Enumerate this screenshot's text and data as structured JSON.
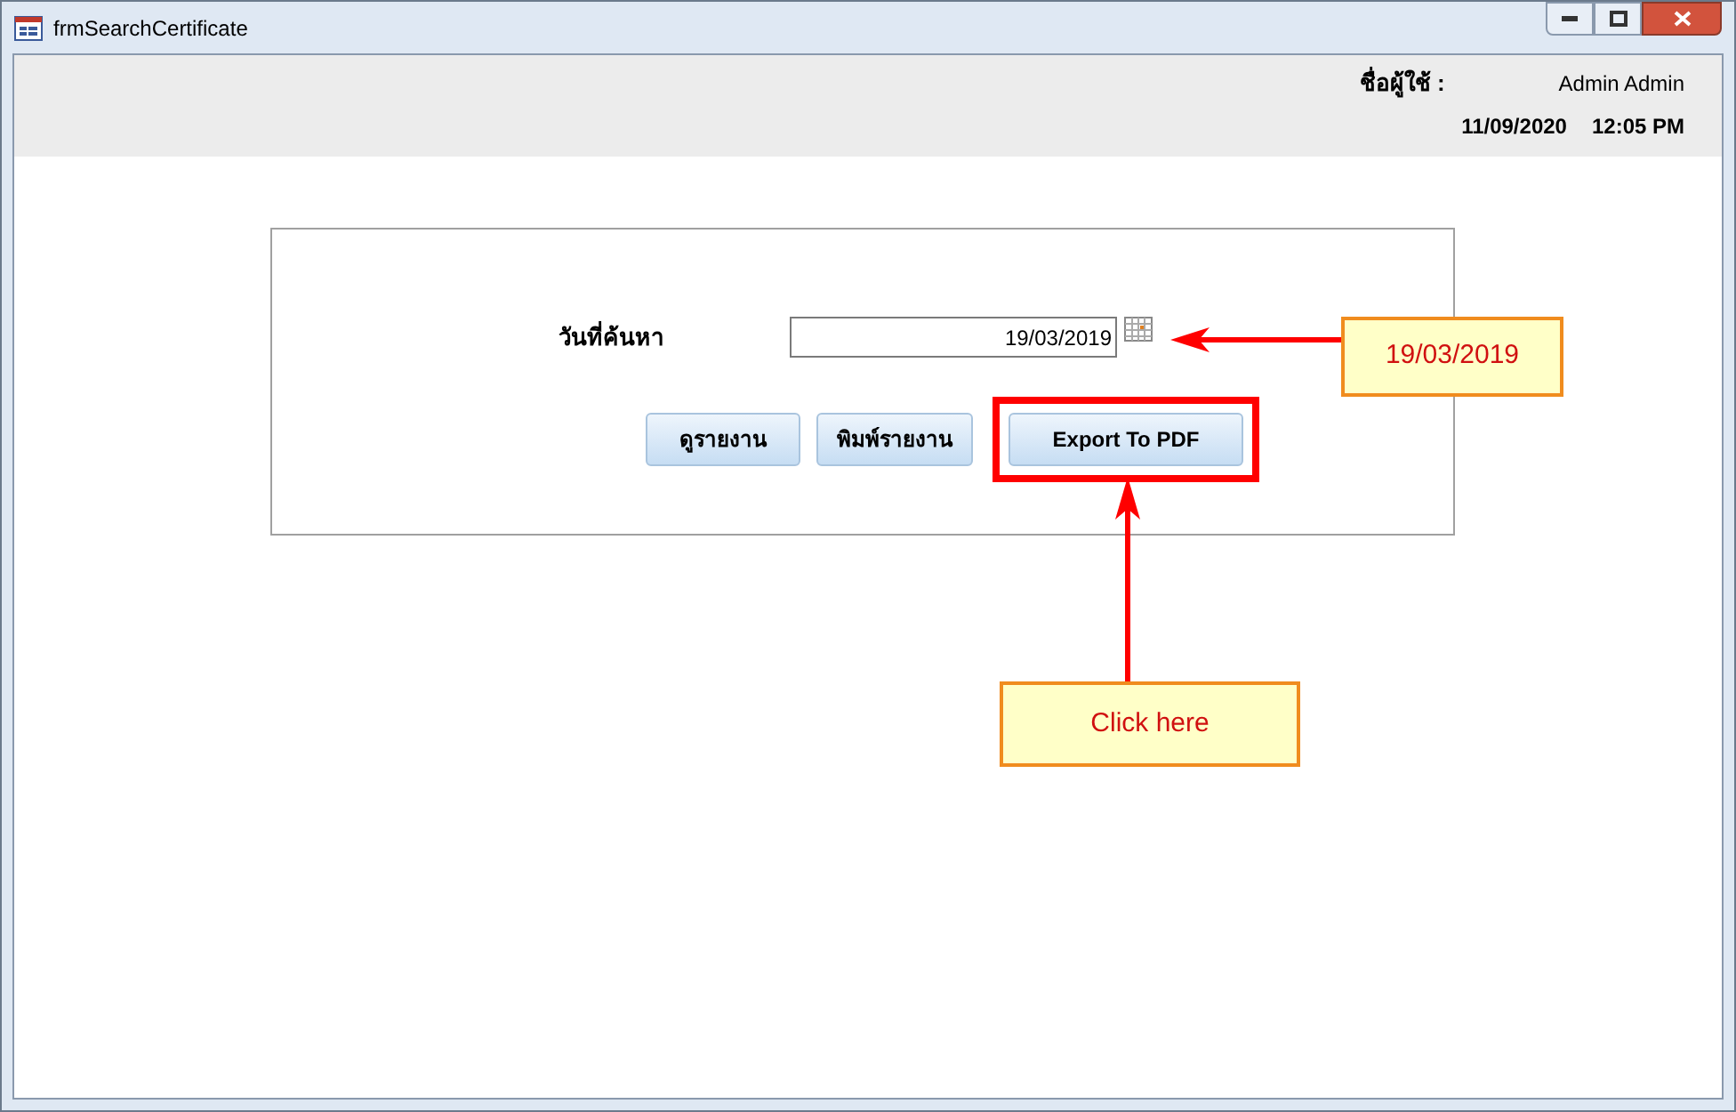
{
  "window": {
    "title": "frmSearchCertificate"
  },
  "header": {
    "user_label": "ชื่อผู้ใช้ :",
    "user_name": "Admin Admin",
    "date": "11/09/2020",
    "time": "12:05 PM"
  },
  "form": {
    "date_label": "วันที่ค้นหา",
    "date_value": "19/03/2019",
    "buttons": [
      {
        "label": "ดูรายงาน",
        "highlighted": false
      },
      {
        "label": "พิมพ์รายงาน",
        "highlighted": false
      },
      {
        "label": "Export To PDF",
        "highlighted": true
      }
    ]
  },
  "annotations": [
    {
      "kind": "arrow-left",
      "text": "19/03/2019"
    },
    {
      "kind": "arrow-up",
      "text": "Click here"
    }
  ]
}
